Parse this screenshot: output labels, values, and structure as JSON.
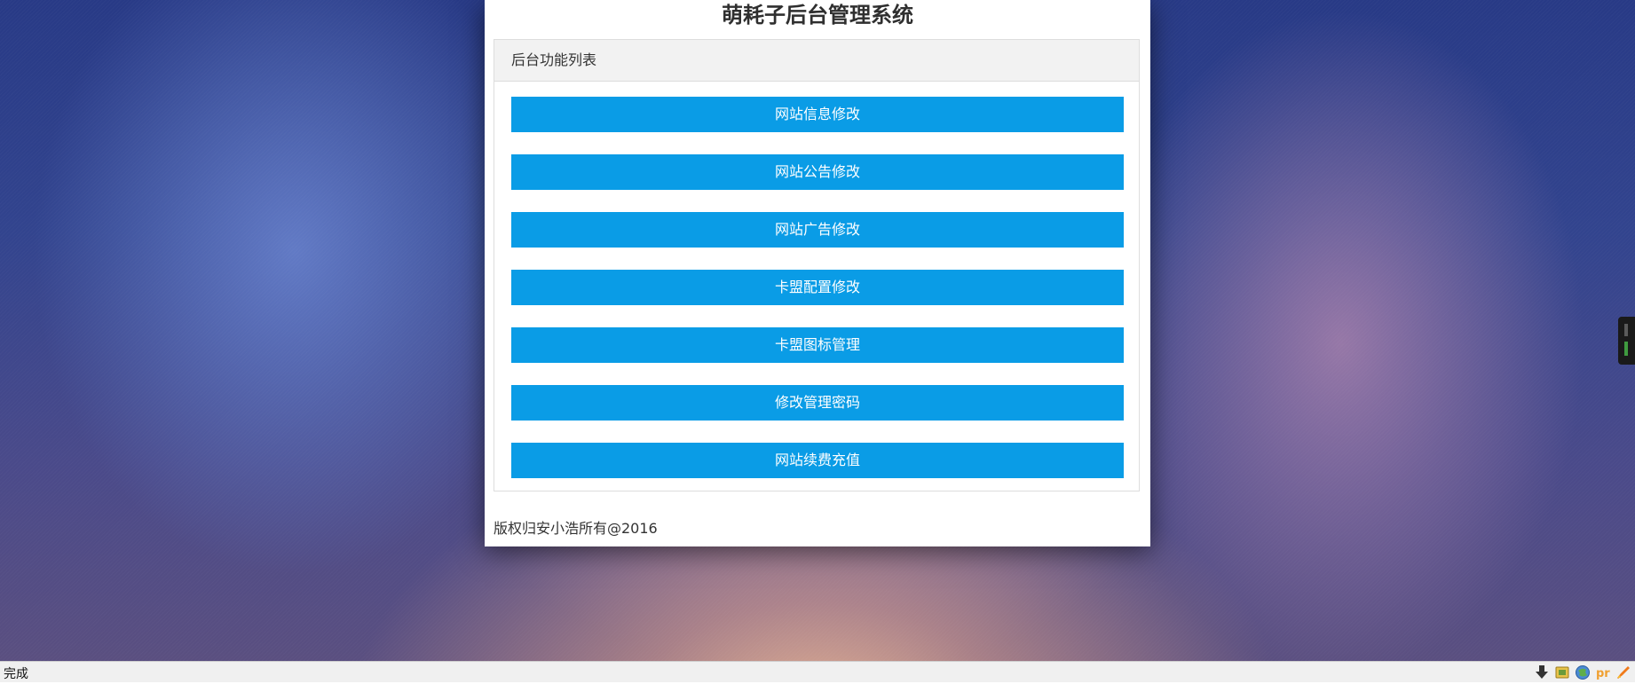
{
  "page": {
    "title": "萌耗子后台管理系统"
  },
  "card": {
    "heading": "后台功能列表"
  },
  "menu": {
    "items": [
      {
        "label": "网站信息修改"
      },
      {
        "label": "网站公告修改"
      },
      {
        "label": "网站广告修改"
      },
      {
        "label": "卡盟配置修改"
      },
      {
        "label": "卡盟图标管理"
      },
      {
        "label": "修改管理密码"
      },
      {
        "label": "网站续费充值"
      }
    ]
  },
  "footer": {
    "copyright": "版权归安小浩所有@2016"
  },
  "statusbar": {
    "text": "完成",
    "icons": [
      "download-icon",
      "extension-icon",
      "globe-icon",
      "pr-icon",
      "rocket-icon"
    ]
  },
  "colors": {
    "button": "#0a9ce6",
    "panel": "#ffffff",
    "card_heading_bg": "#f2f2f2"
  }
}
